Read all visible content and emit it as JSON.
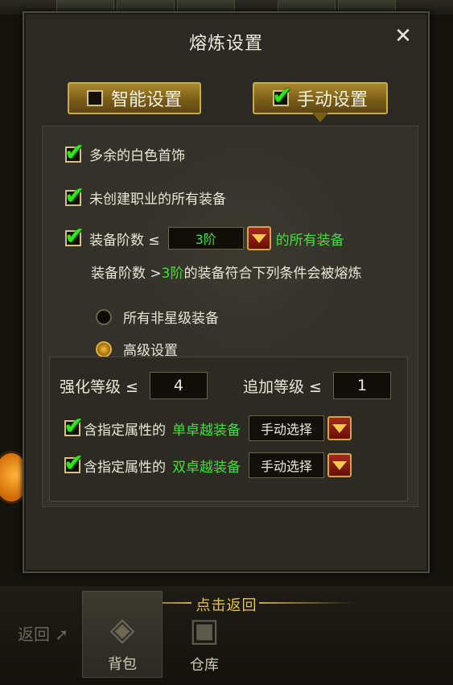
{
  "dialog": {
    "title": "熔炼设置",
    "close_symbol": "✕"
  },
  "tabs": [
    {
      "label": "智能设置",
      "checked": false
    },
    {
      "label": "手动设置",
      "checked": true
    }
  ],
  "options": {
    "white_jewelry": "多余的白色首饰",
    "uncreated_class": "未创建职业的所有装备",
    "stage_prefix": "装备阶数 ≤",
    "stage_value": "3阶",
    "stage_suffix": "的所有装备",
    "condition_prefix": "装备阶数 > ",
    "condition_value": "3阶",
    "condition_suffix": "的装备符合下列条件会被熔炼",
    "radio_non_star": "所有非星级装备",
    "radio_advanced": "高级设置"
  },
  "advanced": {
    "enhance_label": "强化等级 ≤",
    "enhance_value": "4",
    "addition_label": "追加等级 ≤",
    "addition_value": "1",
    "single_prefix": "含指定属性的",
    "single_highlight": "单卓越装备",
    "double_prefix": "含指定属性的",
    "double_highlight": "双卓越装备",
    "select_label": "手动选择"
  },
  "bottom": {
    "return_hint": "点击返回",
    "back_label": "返回",
    "bag_label": "背包",
    "warehouse_label": "仓库"
  },
  "icons": [
    "close-icon",
    "checkbox-checked-icon",
    "dropdown-arrow-icon",
    "radio-icon",
    "backpack-icon",
    "chest-icon",
    "pet-icon"
  ],
  "colors": {
    "accent_green": "#3fe03a",
    "gold": "#c9a94a",
    "dropdown_red": "#a32a1c"
  }
}
